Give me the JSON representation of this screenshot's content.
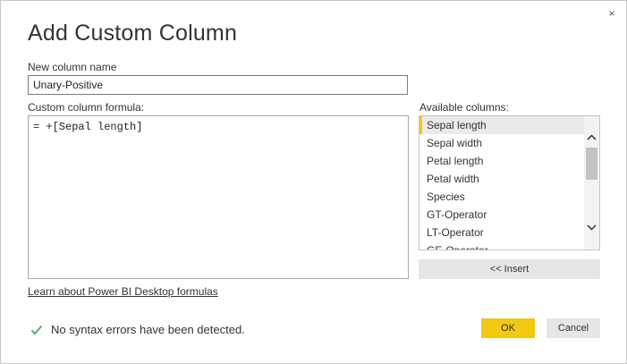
{
  "dialog": {
    "title": "Add Custom Column",
    "close_glyph": "×"
  },
  "name_field": {
    "label": "New column name",
    "value": "Unary-Positive"
  },
  "formula_field": {
    "label": "Custom column formula:",
    "value": "= +[Sepal length]"
  },
  "columns": {
    "label": "Available columns:",
    "items": [
      {
        "label": "Sepal length",
        "selected": true
      },
      {
        "label": "Sepal width",
        "selected": false
      },
      {
        "label": "Petal length",
        "selected": false
      },
      {
        "label": "Petal width",
        "selected": false
      },
      {
        "label": "Species",
        "selected": false
      },
      {
        "label": "GT-Operator",
        "selected": false
      },
      {
        "label": "LT-Operator",
        "selected": false
      },
      {
        "label": "GE-Operator",
        "selected": false
      }
    ],
    "insert_label": "<< Insert"
  },
  "learn_link": "Learn about Power BI Desktop formulas",
  "status": {
    "text": "No syntax errors have been detected.",
    "icon": "check-icon"
  },
  "buttons": {
    "ok": "OK",
    "cancel": "Cancel"
  },
  "colors": {
    "accent": "#f2c811",
    "success": "#4caf73"
  }
}
